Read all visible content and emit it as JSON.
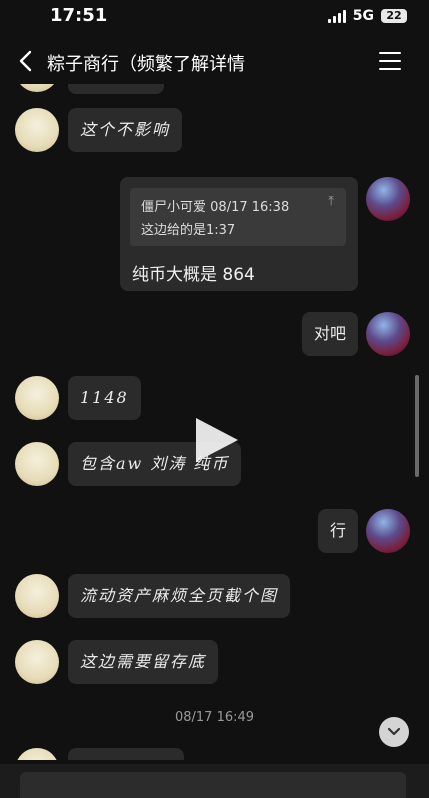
{
  "status": {
    "time": "17:51",
    "network": "5G",
    "battery": "22"
  },
  "header": {
    "title": "粽子商行（频繁了解详情"
  },
  "messages": [
    {
      "side": "left",
      "text": "这个不影响"
    },
    {
      "side": "right",
      "quote_sender": "僵尸小可爱",
      "quote_time": "08/17 16:38",
      "quote_text": "这边给的是1:37",
      "text": "纯币大概是 864"
    },
    {
      "side": "right",
      "text": "对吧"
    },
    {
      "side": "left",
      "text": "1148"
    },
    {
      "side": "left",
      "text": "包含aw 刘涛 纯币"
    },
    {
      "side": "right",
      "text": "行"
    },
    {
      "side": "left",
      "text": "流动资产麻烦全页截个图"
    },
    {
      "side": "left",
      "text": "这边需要留存底"
    }
  ],
  "timestamp": "08/17 16:49",
  "icons": {
    "back": "chevron-left-icon",
    "menu": "hamburger-menu-icon",
    "play": "play-icon",
    "scroll_down": "chevron-down-icon",
    "upward_arrow": "arrow-up-icon"
  },
  "colors": {
    "background": "#111111",
    "bubble": "#2b2b2b",
    "quote": "#3a3a3a"
  }
}
